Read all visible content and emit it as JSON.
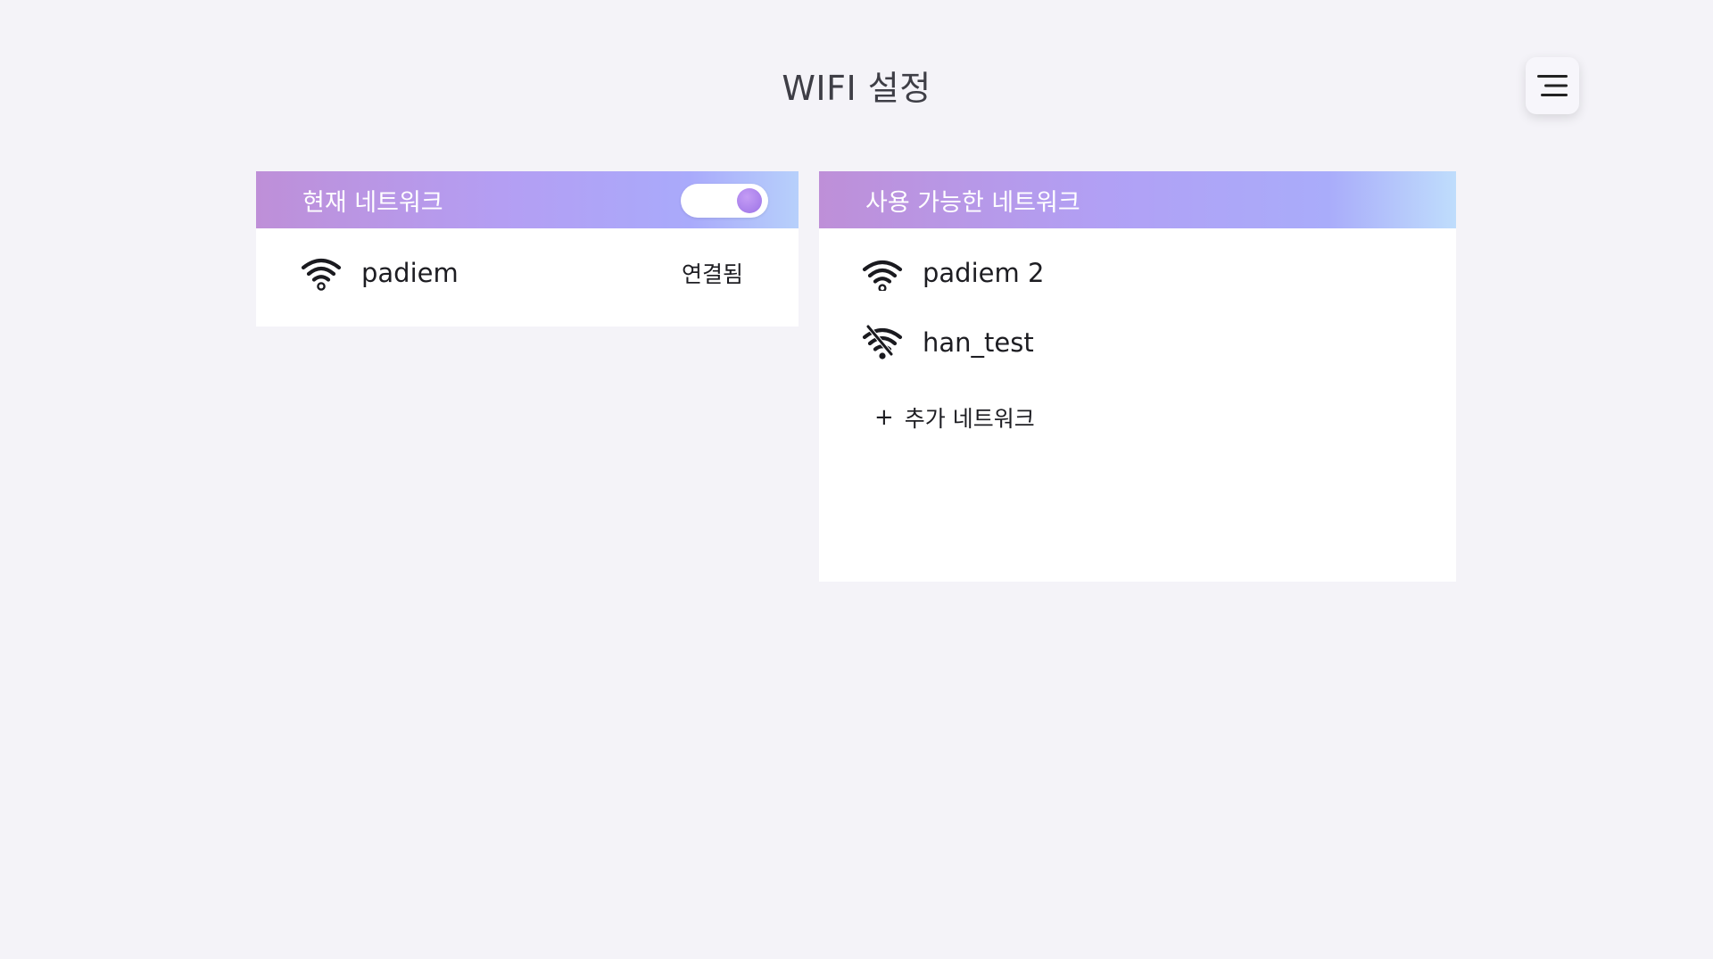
{
  "page": {
    "title": "WIFI 설정"
  },
  "header": {
    "menu_icon": "menu-icon"
  },
  "current_network": {
    "header_label": "현재 네트워크",
    "wifi_enabled": true,
    "network": {
      "ssid": "padiem",
      "status": "연결됨",
      "icon": "wifi-icon"
    }
  },
  "available_networks": {
    "header_label": "사용 가능한 네트워크",
    "items": [
      {
        "ssid": "padiem 2",
        "icon": "wifi-icon"
      },
      {
        "ssid": "han_test",
        "icon": "wifi-off-icon"
      }
    ],
    "add_label": "추가 네트워크",
    "add_icon_glyph": "+"
  },
  "colors": {
    "background": "#f4f3f8",
    "header_gradient_start": "#be8fd8",
    "header_gradient_mid": "#b1a0f5",
    "header_gradient_end": "#bfddfc",
    "toggle_knob": "#9c73e6"
  }
}
